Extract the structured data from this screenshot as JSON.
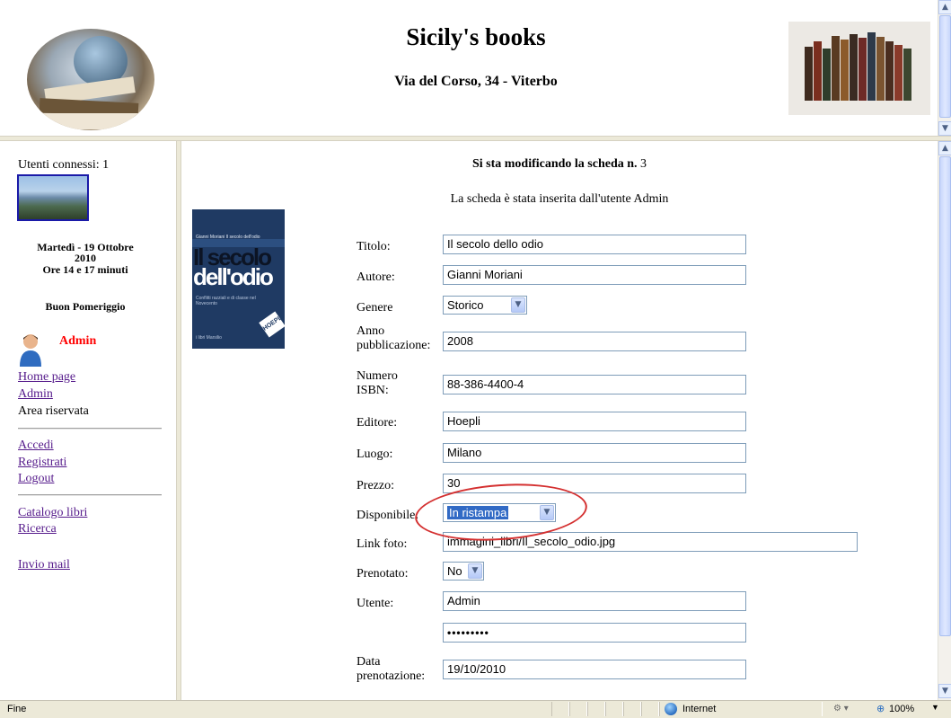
{
  "header": {
    "title": "Sicily's books",
    "address": "Via del Corso, 34 - Viterbo"
  },
  "sidebar": {
    "users_connected": "Utenti connessi: 1",
    "date_line1": "Martedì - 19 Ottobre",
    "date_line2": "2010",
    "date_line3": "Ore 14 e 17 minuti",
    "greeting": "Buon Pomeriggio",
    "admin_name": "Admin",
    "links": {
      "home": "Home page",
      "admin": "Admin",
      "reserved": "Area riservata",
      "login": "Accedi",
      "register": "Registrati",
      "logout": "Logout",
      "catalog": "Catalogo libri",
      "search": "Ricerca",
      "mail": "Invio mail"
    }
  },
  "main": {
    "editing_prefix": "Si sta modificando la scheda n.",
    "editing_number": "3",
    "inserted_by": "La scheda è stata inserita dall'utente Admin",
    "cover": {
      "author": "Gianni Moriani",
      "short_title": "Il secolo dell'odio",
      "big1": "Il secolo",
      "big2": "dell'odio",
      "subtitle": "Conflitti razziali e di classe nel Novecento",
      "publisher_series": "i libri Marsilio",
      "badge": "HOEPLI"
    },
    "fields": {
      "titolo": {
        "label": "Titolo:",
        "value": "Il secolo dello odio"
      },
      "autore": {
        "label": "Autore:",
        "value": "Gianni Moriani"
      },
      "genere": {
        "label": "Genere",
        "value": "Storico"
      },
      "anno": {
        "label1": "Anno",
        "label2": "pubblicazione:",
        "value": "2008"
      },
      "isbn": {
        "label1": "Numero",
        "label2": "ISBN:",
        "value": "88-386-4400-4"
      },
      "editore": {
        "label": "Editore:",
        "value": "Hoepli"
      },
      "luogo": {
        "label": "Luogo:",
        "value": "Milano"
      },
      "prezzo": {
        "label": "Prezzo:",
        "value": "30"
      },
      "disponibile": {
        "label": "Disponibile:",
        "value": "In ristampa"
      },
      "link_foto": {
        "label": "Link foto:",
        "value": "immagini_libri/Il_secolo_odio.jpg"
      },
      "prenotato": {
        "label": "Prenotato:",
        "value": "No"
      },
      "utente": {
        "label": "Utente:",
        "value": "Admin"
      },
      "password": {
        "value": "•••••••••"
      },
      "data_prenotazione": {
        "label1": "Data",
        "label2": "prenotazione:",
        "value": "19/10/2010"
      }
    }
  },
  "statusbar": {
    "status": "Fine",
    "zone": "Internet",
    "zoom": "100%"
  },
  "colors": {
    "admin_name": "#ff0000",
    "link": "#551a8b",
    "annotation_ellipse": "#d43030",
    "selected_option_bg": "#316ac5"
  },
  "icons": {
    "user_avatar": "user-avatar-icon",
    "internet_zone": "globe-icon",
    "zoom": "magnifier-icon"
  }
}
